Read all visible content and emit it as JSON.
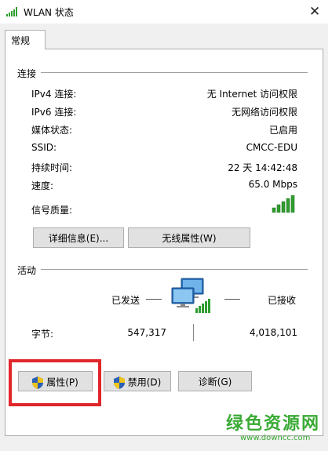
{
  "window": {
    "title": "WLAN 状态",
    "close_glyph": "✕"
  },
  "tabs": [
    {
      "label": "常规"
    }
  ],
  "connection": {
    "section_label": "连接",
    "rows": [
      {
        "label": "IPv4 连接:",
        "value": "无 Internet 访问权限"
      },
      {
        "label": "IPv6 连接:",
        "value": "无网络访问权限"
      },
      {
        "label": "媒体状态:",
        "value": "已启用"
      },
      {
        "label": "SSID:",
        "value": "CMCC-EDU"
      },
      {
        "label": "持续时间:",
        "value": "22 天 14:42:48"
      },
      {
        "label": "速度:",
        "value": "65.0 Mbps"
      }
    ],
    "signal_label": "信号质量:",
    "signal_bars": 5,
    "details_button": "详细信息(E)...",
    "wireless_props_button": "无线属性(W)"
  },
  "activity": {
    "section_label": "活动",
    "sent_label": "已发送",
    "received_label": "已接收",
    "bytes_label": "字节:",
    "bytes_sent": "547,317",
    "bytes_received": "4,018,101"
  },
  "buttons": {
    "properties": "属性(P)",
    "disable": "禁用(D)",
    "diagnose": "诊断(G)"
  },
  "watermark": {
    "main": "绿色资源网",
    "sub": "www.downcc.com"
  },
  "colors": {
    "signal_green": "#2f9e2f",
    "highlight_red": "#e0262b",
    "watermark_green": "#3aaa35"
  }
}
